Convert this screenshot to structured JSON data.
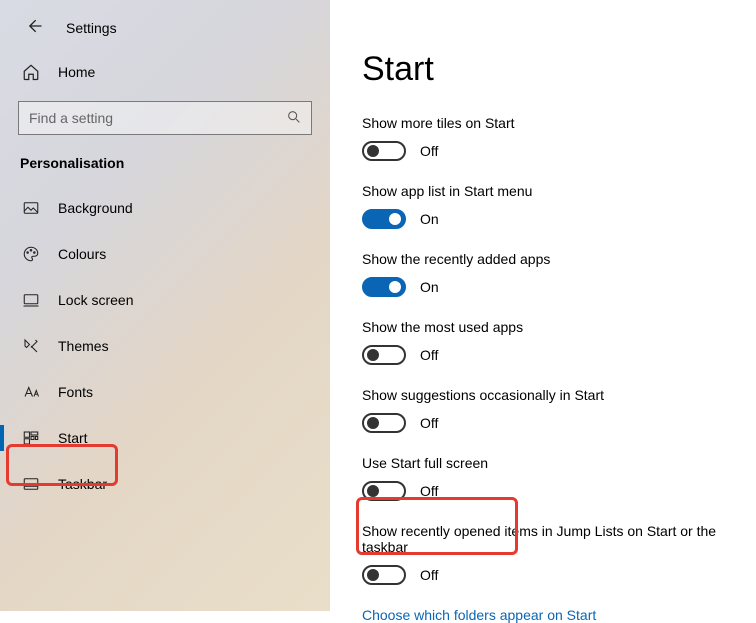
{
  "header": {
    "title": "Settings",
    "home": "Home"
  },
  "search": {
    "placeholder": "Find a setting"
  },
  "group": "Personalisation",
  "nav": [
    {
      "label": "Background"
    },
    {
      "label": "Colours"
    },
    {
      "label": "Lock screen"
    },
    {
      "label": "Themes"
    },
    {
      "label": "Fonts"
    },
    {
      "label": "Start"
    },
    {
      "label": "Taskbar"
    }
  ],
  "page": {
    "title": "Start"
  },
  "settings": {
    "moreTiles": {
      "label": "Show more tiles on Start",
      "on": false,
      "state": "Off"
    },
    "appList": {
      "label": "Show app list in Start menu",
      "on": true,
      "state": "On"
    },
    "recentlyAdded": {
      "label": "Show the recently added apps",
      "on": true,
      "state": "On"
    },
    "mostUsed": {
      "label": "Show the most used apps",
      "on": false,
      "state": "Off"
    },
    "suggestions": {
      "label": "Show suggestions occasionally in Start",
      "on": false,
      "state": "Off"
    },
    "fullScreen": {
      "label": "Use Start full screen",
      "on": false,
      "state": "Off"
    },
    "jumpLists": {
      "label": "Show recently opened items in Jump Lists on Start or the taskbar",
      "on": false,
      "state": "Off"
    }
  },
  "link": "Choose which folders appear on Start"
}
